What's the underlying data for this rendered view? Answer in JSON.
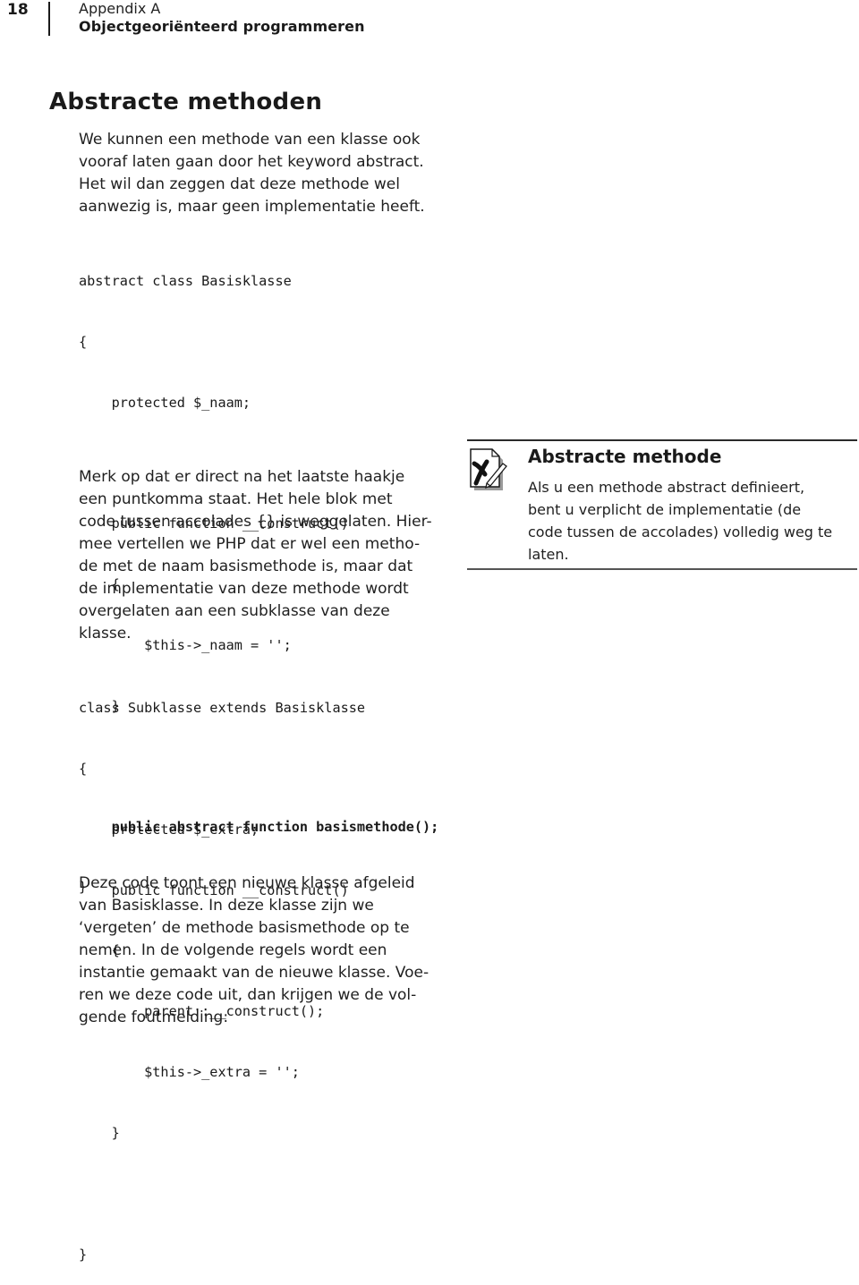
{
  "header": {
    "page_number": "18",
    "chapter": "Appendix A",
    "title": "Objectgeoriënteerd programmeren"
  },
  "section": {
    "heading": "Abstracte methoden"
  },
  "intro_paragraph": {
    "lines": [
      "We kunnen een methode van een klasse ook",
      "vooraf laten gaan door het keyword abstract.",
      "Het wil dan zeggen dat deze methode wel",
      "aanwezig is, maar geen implementatie heeft."
    ]
  },
  "code_block_1": {
    "lines": [
      {
        "text": "abstract class Basisklasse",
        "bold": false
      },
      {
        "text": "{",
        "bold": false
      },
      {
        "text": "    protected $_naam;",
        "bold": false
      },
      {
        "text": "",
        "bold": false
      },
      {
        "text": "    public function __construct()",
        "bold": false
      },
      {
        "text": "    {",
        "bold": false
      },
      {
        "text": "        $this->_naam = '';",
        "bold": false
      },
      {
        "text": "    }",
        "bold": false
      },
      {
        "text": "",
        "bold": false
      },
      {
        "text": "    public abstract function basismethode();",
        "bold": true
      },
      {
        "text": "}",
        "bold": false
      }
    ]
  },
  "explanation_paragraph": {
    "lines": [
      "Merk op dat er direct na het laatste haakje",
      "een puntkomma staat. Het hele blok met",
      "code tussen accolades {} is weggelaten. Hier-",
      "mee vertellen we PHP dat er wel een metho-",
      "de met de naam basismethode is, maar dat",
      "de implementatie van deze methode wordt",
      "overgelaten aan een subklasse van deze",
      "klasse."
    ]
  },
  "note": {
    "icon": "checklist-note-icon",
    "title": "Abstracte methode",
    "lines": [
      "Als u een methode abstract definieert,",
      "bent u verplicht de implementatie (de",
      "code tussen de accolades) volledig weg te",
      "laten."
    ]
  },
  "code_block_2": {
    "lines": [
      {
        "text": "class Subklasse extends Basisklasse",
        "bold": false
      },
      {
        "text": "{",
        "bold": false
      },
      {
        "text": "    protected $_extra;",
        "bold": false
      },
      {
        "text": "    public function __construct()",
        "bold": false
      },
      {
        "text": "    {",
        "bold": false
      },
      {
        "text": "        parent::__construct();",
        "bold": false
      },
      {
        "text": "        $this->_extra = '';",
        "bold": false
      },
      {
        "text": "    }",
        "bold": false
      },
      {
        "text": "",
        "bold": false
      },
      {
        "text": "}",
        "bold": false
      }
    ]
  },
  "closing_paragraph": {
    "lines": [
      "Deze code toont een nieuwe klasse afgeleid",
      "van Basisklasse. In deze klasse zijn we",
      "‘vergeten’ de methode basismethode op te",
      "nemen. In de volgende regels wordt een",
      "instantie gemaakt van de nieuwe klasse. Voe-",
      "ren we deze code uit, dan krijgen we de vol-",
      "gende foutmelding:"
    ]
  }
}
